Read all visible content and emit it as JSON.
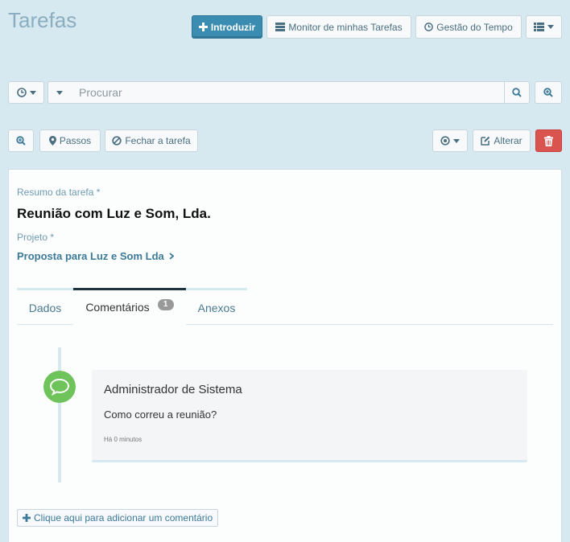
{
  "page": {
    "title": "Tarefas"
  },
  "toolbar": {
    "introduzir_label": "Introduzir",
    "monitor_label": "Monitor de minhas Tarefas",
    "gestao_label": "Gestão do Tempo"
  },
  "search": {
    "placeholder": "Procurar"
  },
  "actions": {
    "passos_label": "Passos",
    "fechar_label": "Fechar a tarefa",
    "alterar_label": "Alterar"
  },
  "task": {
    "summary_label": "Resumo da tarefa",
    "required_mark": "*",
    "summary": "Reunião com Luz e Som, Lda.",
    "project_label": "Projeto",
    "project": "Proposta para Luz e Som Lda"
  },
  "tabs": [
    {
      "label": "Dados"
    },
    {
      "label": "Comentários",
      "badge": "1"
    },
    {
      "label": "Anexos"
    }
  ],
  "comments": [
    {
      "author": "Administrador de Sistema",
      "text": "Como correu a reunião?",
      "time": "Há 0 minutos"
    }
  ],
  "add_comment_label": "Clique aqui para adicionar um comentário",
  "colors": {
    "primary": "#3a8cb0",
    "danger": "#d9534f",
    "comment_icon": "#6ec45a",
    "background": "#d6e8f0"
  }
}
